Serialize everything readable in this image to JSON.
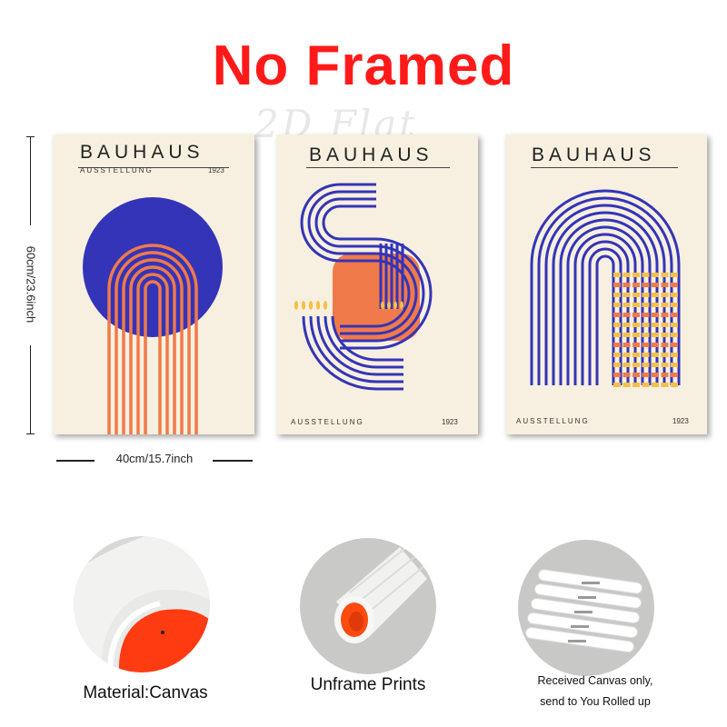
{
  "header": {
    "title": "No Framed",
    "watermark": "2D Flat"
  },
  "colors": {
    "headline": "#ff1a1a",
    "poster_bg": "#f7f0e0",
    "blue": "#3434b8",
    "orange": "#f07a4a",
    "yellow": "#f5c04a"
  },
  "dimensions": {
    "height_label": "60cm/23.6inch",
    "width_label": "40cm/15.7inch"
  },
  "posters": [
    {
      "title": "BAUHAUS",
      "subtitle": "AUSSTELLUNG",
      "year": "1923"
    },
    {
      "title": "BAUHAUS",
      "subtitle": "AUSSTELLUNG",
      "year": "1923"
    },
    {
      "title": "BAUHAUS",
      "subtitle": "AUSSTELLUNG",
      "year": "1923"
    }
  ],
  "features": [
    {
      "caption": "Material:Canvas",
      "icon": "canvas-corner-photo"
    },
    {
      "caption": "Unframe  Prints",
      "icon": "rolled-canvas-photo"
    },
    {
      "caption_line1": "Received Canvas only,",
      "caption_line2": "send to You Rolled up",
      "icon": "rolled-tubes-photo"
    }
  ]
}
